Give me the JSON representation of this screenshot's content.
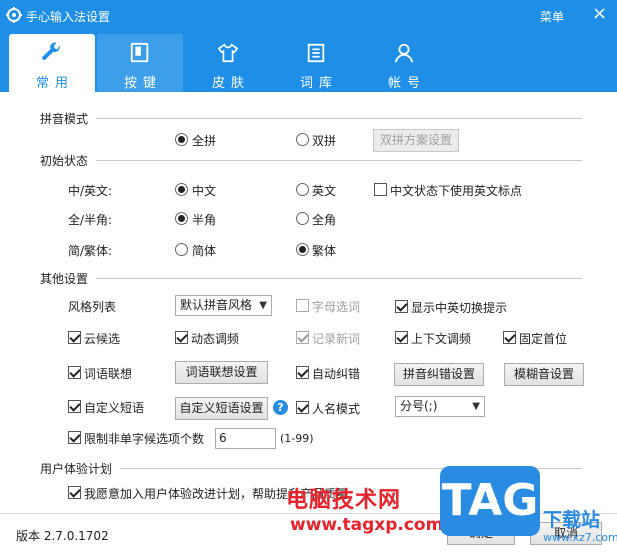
{
  "window": {
    "title": "手心输入法设置",
    "menu": "菜单",
    "close": "×"
  },
  "tabs": [
    {
      "label": "常用",
      "icon": "wrench-icon"
    },
    {
      "label": "按键",
      "icon": "keys-icon"
    },
    {
      "label": "皮肤",
      "icon": "shirt-icon"
    },
    {
      "label": "词库",
      "icon": "dictionary-icon"
    },
    {
      "label": "帐号",
      "icon": "user-icon"
    }
  ],
  "pinyin_mode": {
    "title": "拼音模式",
    "full": "全拼",
    "double": "双拼",
    "double_settings": "双拼方案设置"
  },
  "initial_state": {
    "title": "初始状态",
    "cn_en_label": "中/英文:",
    "cn": "中文",
    "en": "英文",
    "cn_en_punct": "中文状态下使用英文标点",
    "width_label": "全/半角:",
    "half": "半角",
    "full": "全角",
    "script_label": "简/繁体:",
    "simplified": "简体",
    "traditional": "繁体"
  },
  "other": {
    "title": "其他设置",
    "style_list_label": "风格列表",
    "style_value": "默认拼音风格",
    "letter_select": "字母选词",
    "show_switch_tip": "显示中英切换提示",
    "cloud_candidate": "云候选",
    "dynamic_freq": "动态调频",
    "record_new_words": "记录新词",
    "context_freq": "上下文调频",
    "fixed_first": "固定首位",
    "word_assoc": "词语联想",
    "word_assoc_settings": "词语联想设置",
    "auto_correct": "自动纠错",
    "pinyin_correct_settings": "拼音纠错设置",
    "fuzzy_settings": "模糊音设置",
    "custom_phrase": "自定义短语",
    "custom_phrase_settings": "自定义短语设置",
    "help": "?",
    "name_mode": "人名模式",
    "name_mode_value": "分号(;)",
    "limit_candidates": "限制非单字候选项个数",
    "limit_value": "6",
    "limit_range": "(1-99)"
  },
  "ux_plan": {
    "title": "用户体验计划",
    "join": "我愿意加入用户体验改进计划，帮助提升产品质量"
  },
  "footer": {
    "version": "版本 2.7.0.1702",
    "ok": "确定",
    "cancel": "取消"
  },
  "watermark": {
    "site_name": "电脑技术网",
    "url": "www.tagxp.com",
    "logo": "TAG",
    "side_text": "下载站",
    "side_url": "www.xz7.com"
  },
  "colors": {
    "accent": "#1e8ee6",
    "watermark_red": "#e8232b"
  }
}
